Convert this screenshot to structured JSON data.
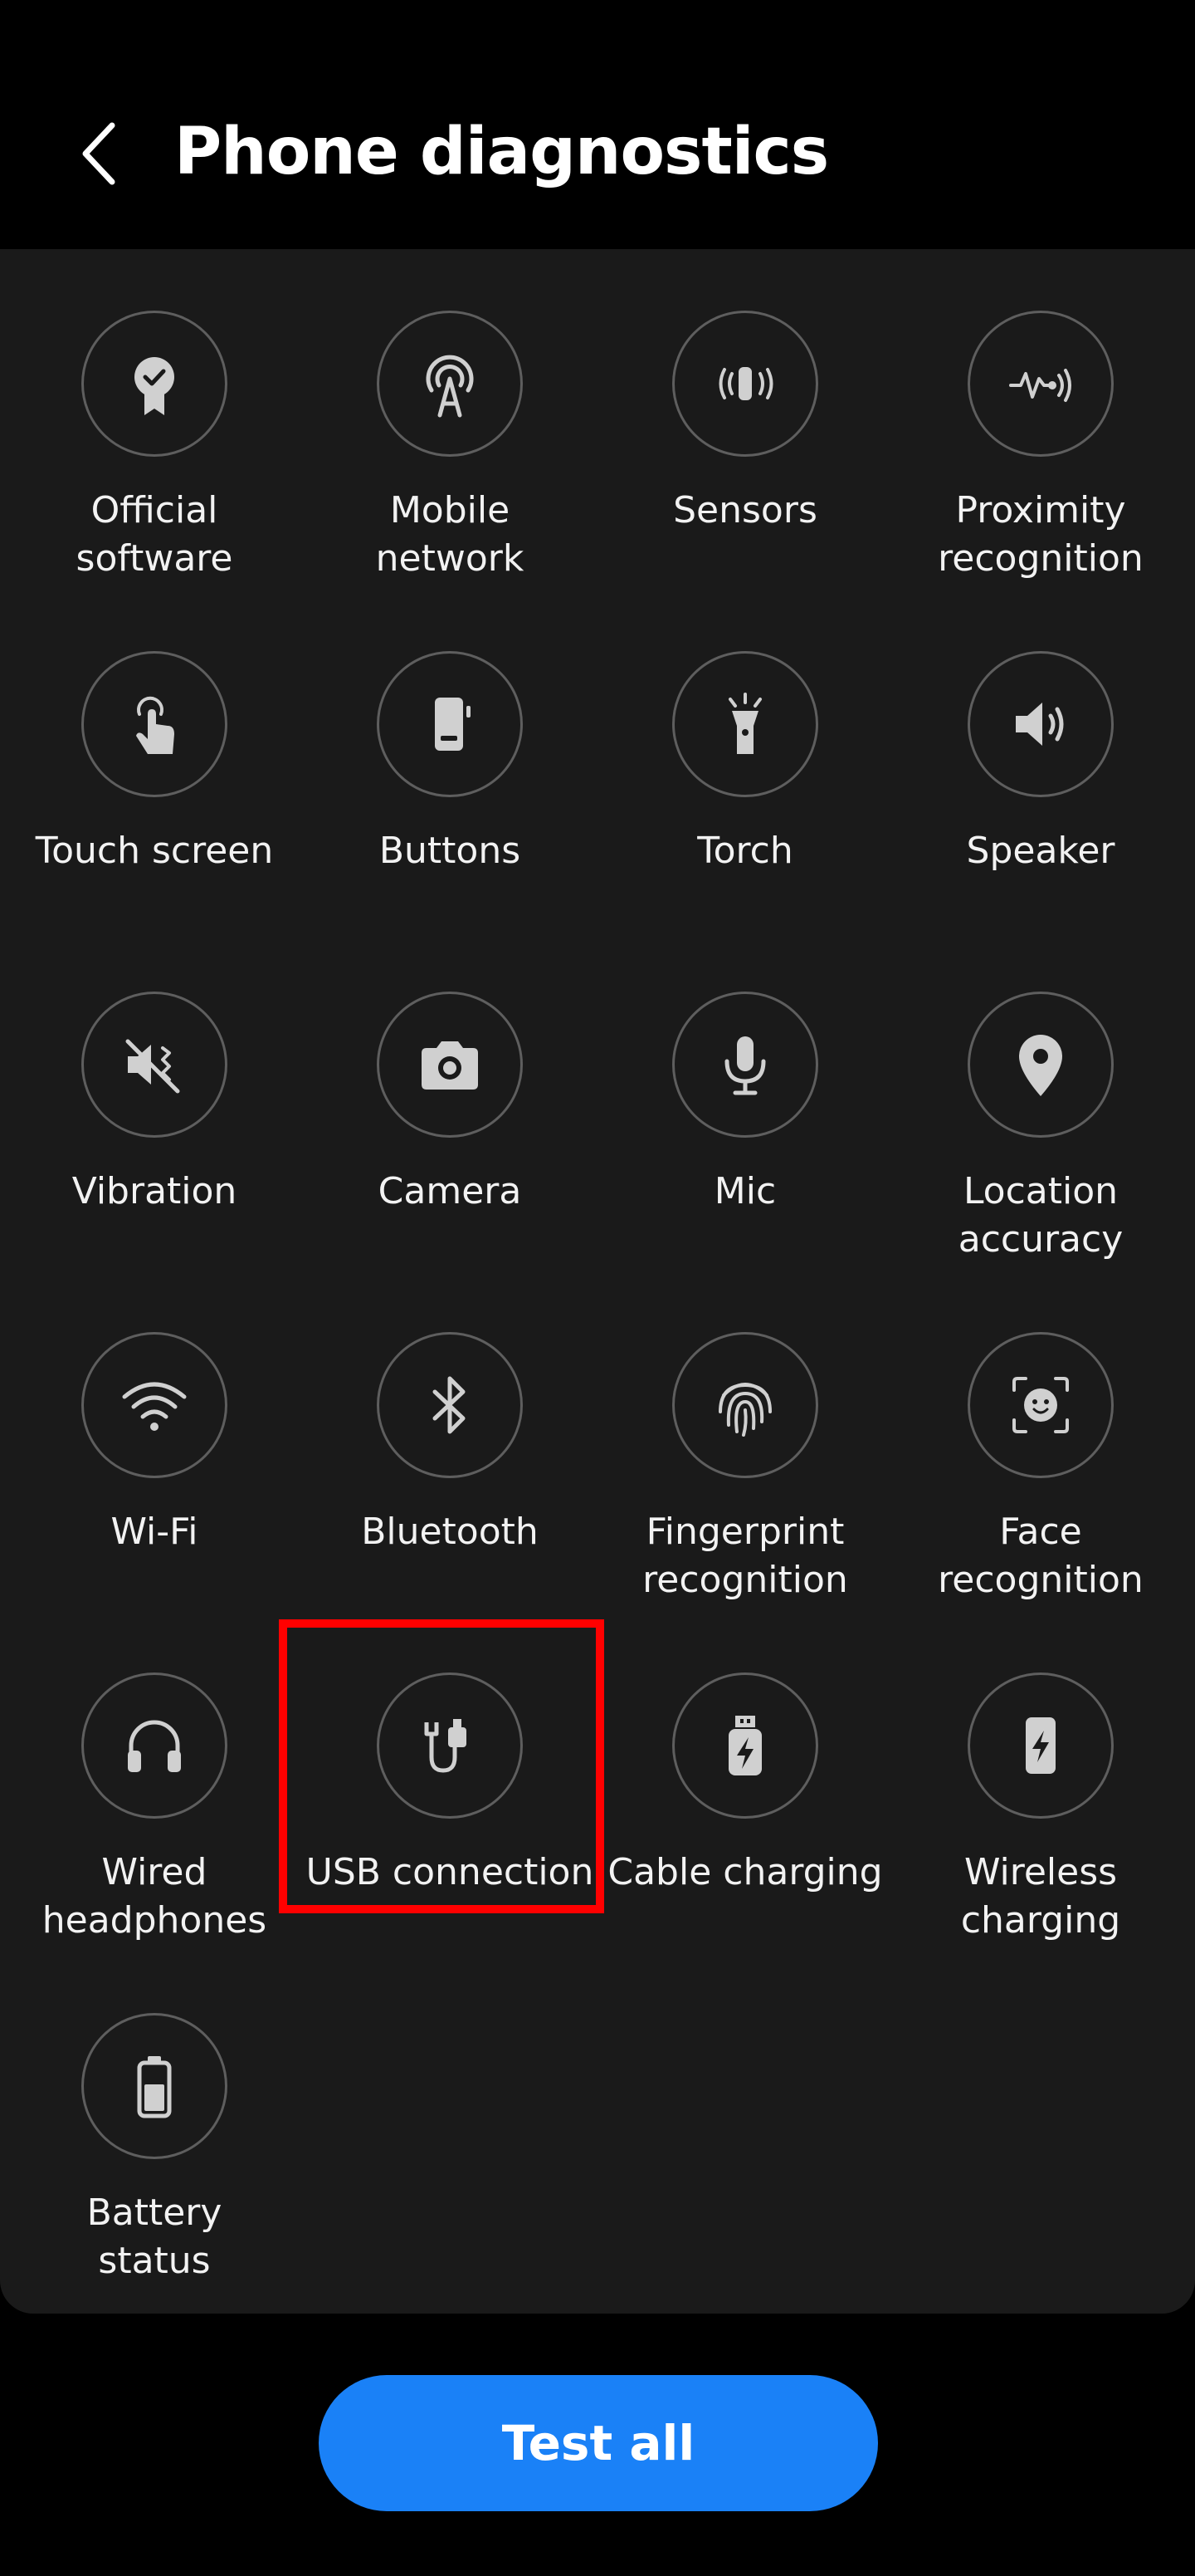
{
  "header": {
    "title": "Phone diagnostics",
    "back_icon": "chevron-left-icon"
  },
  "tiles": [
    {
      "label": "Official\nsoftware",
      "icon": "certified-badge-icon"
    },
    {
      "label": "Mobile\nnetwork",
      "icon": "antenna-icon"
    },
    {
      "label": "Sensors",
      "icon": "sensor-icon"
    },
    {
      "label": "Proximity\nrecognition",
      "icon": "proximity-wave-icon"
    },
    {
      "label": "Touch screen",
      "icon": "touch-hand-icon"
    },
    {
      "label": "Buttons",
      "icon": "phone-buttons-icon"
    },
    {
      "label": "Torch",
      "icon": "flashlight-icon"
    },
    {
      "label": "Speaker",
      "icon": "speaker-icon"
    },
    {
      "label": "Vibration",
      "icon": "vibration-icon"
    },
    {
      "label": "Camera",
      "icon": "camera-icon"
    },
    {
      "label": "Mic",
      "icon": "microphone-icon"
    },
    {
      "label": "Location\naccuracy",
      "icon": "location-pin-icon"
    },
    {
      "label": "Wi-Fi",
      "icon": "wifi-icon"
    },
    {
      "label": "Bluetooth",
      "icon": "bluetooth-icon"
    },
    {
      "label": "Fingerprint\nrecognition",
      "icon": "fingerprint-icon"
    },
    {
      "label": "Face\nrecognition",
      "icon": "face-scan-icon"
    },
    {
      "label": "Wired\nheadphones",
      "icon": "headphones-icon"
    },
    {
      "label": "USB connection",
      "icon": "usb-cable-icon"
    },
    {
      "label": "Cable charging",
      "icon": "cable-charging-icon"
    },
    {
      "label": "Wireless\ncharging",
      "icon": "wireless-charging-icon"
    },
    {
      "label": "Battery\nstatus",
      "icon": "battery-icon"
    }
  ],
  "footer": {
    "test_all_label": "Test all"
  },
  "colors": {
    "background": "#000000",
    "panel": "#1a1a1a",
    "icon_ring": "#5e5e5e",
    "icon_fill": "#d0d0d0",
    "accent": "#1a81f7",
    "highlight": "#ff0000"
  }
}
